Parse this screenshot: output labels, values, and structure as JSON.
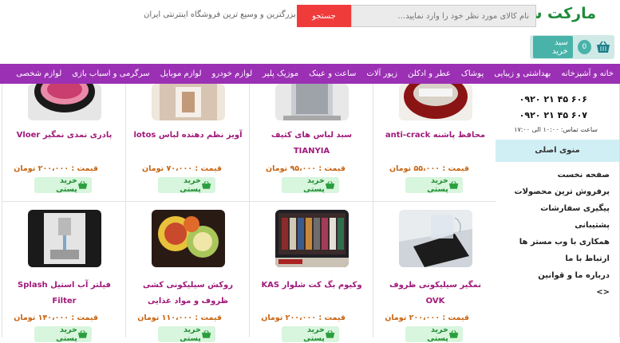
{
  "header": {
    "logo": "مارکت شاپ",
    "search_placeholder": "نام کالای مورد نظر خود را وارد نمایید...",
    "search_button": "جستجو",
    "tagline": "بزرگترین و وسیع ترین فروشگاه اینترنتی ایران",
    "cart_count": "0",
    "cart_button": "سبد خرید"
  },
  "nav": {
    "items": [
      "خانه و آشپزخانه",
      "بهداشتی و زیبایی",
      "پوشاک",
      "عطر و ادکلن",
      "زیور آلات",
      "ساعت و عینک",
      "موزیک پلیر",
      "لوازم خودرو",
      "لوازم موبایل",
      "سرگرمی و اسباب بازی",
      "لوازم شخصی"
    ]
  },
  "products": [
    {
      "title": "محافظ پاشنه anti-crack",
      "price": "قیمت : ۵۵،۰۰۰ تومان",
      "buy": "خرید پستی"
    },
    {
      "title": "سبد لباس های کثیف TIANYIA",
      "price": "قیمت : ۹۵،۰۰۰ تومان",
      "buy": "خرید پستی"
    },
    {
      "title": "آویز نظم دهنده لباس lotos",
      "price": "قیمت : ۷۰،۰۰۰ تومان",
      "buy": "خرید پستی"
    },
    {
      "title": "پادری نمدی نمگیر Vloer",
      "price": "قیمت : ۲۰۰،۰۰۰ تومان",
      "buy": "خرید پستی"
    },
    {
      "title": "نمگیر سیلیکونی ظروف OVK",
      "price": "قیمت : ۲۰۰،۰۰۰ تومان",
      "buy": "خرید پستی"
    },
    {
      "title": "وکیوم بگ کت شلوار KAS",
      "price": "قیمت : ۲۰۰،۰۰۰ تومان",
      "buy": "خرید پستی"
    },
    {
      "title": "روکش سیلیکونی کشی ظروف و مواد غذایی",
      "price": "قیمت : ۱۱۰،۰۰۰ تومان",
      "buy": "خرید پستی"
    },
    {
      "title": "فیلتر آب استیل Splash Filter",
      "price": "قیمت : ۱۴۰،۰۰۰ تومان",
      "buy": "خرید پستی"
    }
  ],
  "sidebar": {
    "phones": [
      "۰۹۲۰ ۲۱ ۴۵ ۶۰۶",
      "۰۹۲۰ ۲۱ ۴۵ ۶۰۷"
    ],
    "hours": "ساعت تماس: ۱۰:۰۰ الی ۱۷:۰۰",
    "menu_title": "منوی اصلی",
    "menu_items": [
      "صفحه نخست",
      "پرفروش ترین محصولات",
      "پیگیری سفارشات",
      "پشتیبانی",
      "همکاری با وب مستر ها",
      "ارتباط با ما",
      "درباره ما و قوانین",
      "<>"
    ]
  },
  "colors": {
    "nav_bg": "#9b30b4",
    "title": "#a0197a",
    "price": "#c7630f",
    "buy_bg": "#d8f5dd",
    "search_btn": "#f03b3b",
    "logo": "#1e8c3c"
  }
}
